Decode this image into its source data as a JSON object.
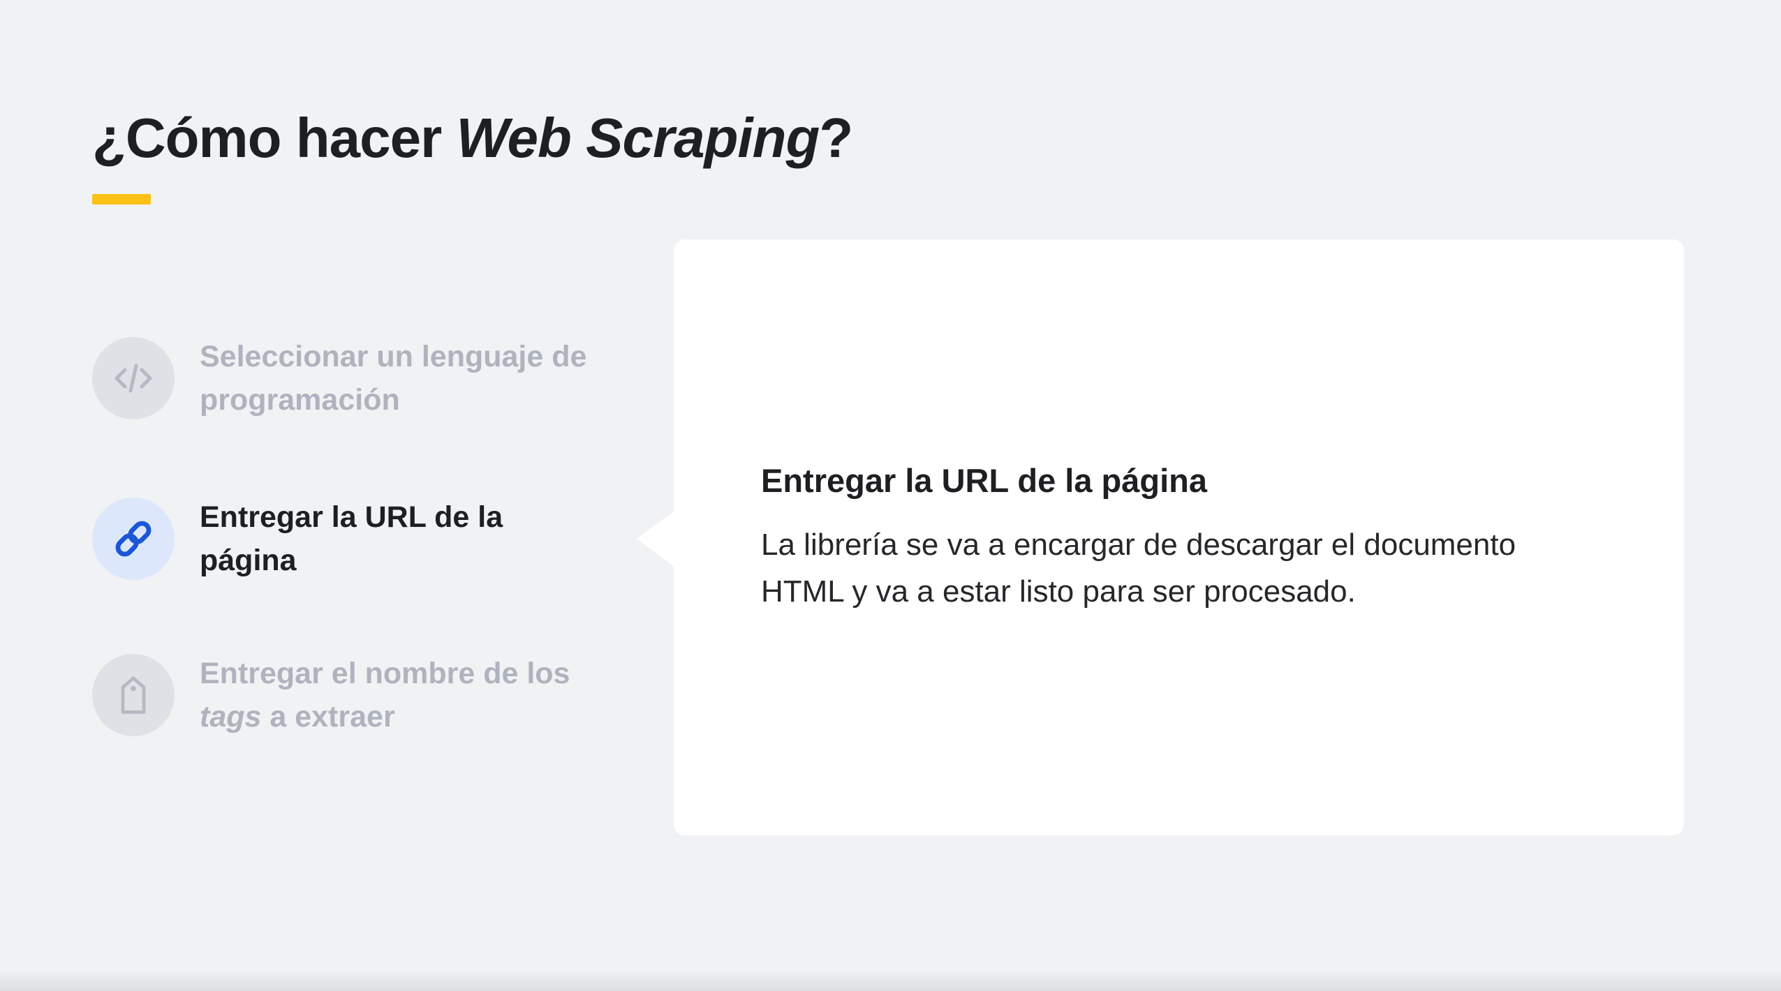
{
  "slide": {
    "title_prefix": "¿Cómo hacer ",
    "title_emphasis": "Web Scraping",
    "title_suffix": "?",
    "accent_color": "#fbc114"
  },
  "steps": [
    {
      "icon": "code-icon",
      "label": "Seleccionar un lenguaje de programación",
      "active": false
    },
    {
      "icon": "link-icon",
      "label": "Entregar la URL de la página",
      "active": true
    },
    {
      "icon": "tag-icon",
      "label_prefix": "Entregar el nombre de los ",
      "label_emphasis": "tags",
      "label_suffix": " a extraer",
      "active": false
    }
  ],
  "detail_card": {
    "title": "Entregar la URL de la página",
    "text": "La librería se va a encargar de descargar el documento HTML y va a estar listo para ser procesado."
  },
  "colors": {
    "active_icon": "#1a56d6",
    "inactive_icon": "#b5b9c3",
    "inactive_text": "#aeb3be",
    "background": "#f1f2f4"
  }
}
